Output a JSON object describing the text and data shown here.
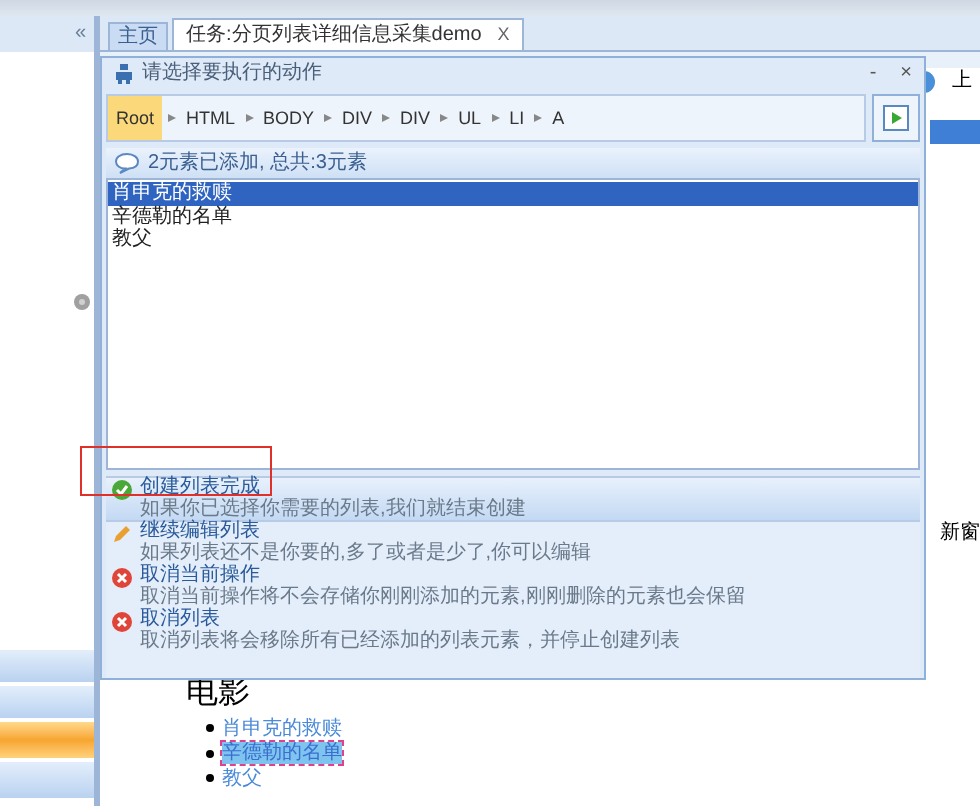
{
  "app": {
    "collapse_glyph": "«",
    "tabs": [
      {
        "label": "主页",
        "selected": false
      },
      {
        "label": "任务:分页列表详细信息采集demo",
        "selected": true
      }
    ],
    "tab_close": "X",
    "right_text": "上",
    "right_side_text": "新窗"
  },
  "dialog": {
    "title": "请选择要执行的动作",
    "minimize": "-",
    "close": "×",
    "breadcrumbs": [
      {
        "label": "Root",
        "selected": true
      },
      {
        "label": "HTML",
        "selected": false
      },
      {
        "label": "BODY",
        "selected": false
      },
      {
        "label": "DIV",
        "selected": false
      },
      {
        "label": "DIV",
        "selected": false
      },
      {
        "label": "UL",
        "selected": false
      },
      {
        "label": "LI",
        "selected": false
      },
      {
        "label": "A",
        "selected": false
      }
    ],
    "status": "2元素已添加, 总共:3元素",
    "elements": [
      {
        "label": "肖申克的救赎",
        "selected": true
      },
      {
        "label": "辛德勒的名单",
        "selected": false
      },
      {
        "label": "教父",
        "selected": false
      }
    ],
    "actions": [
      {
        "kind": "done",
        "title": "创建列表完成",
        "description": "如果你已选择你需要的列表,我们就结束创建",
        "selected": true
      },
      {
        "kind": "edit",
        "title": "继续编辑列表",
        "description": "如果列表还不是你要的,多了或者是少了,你可以编辑",
        "selected": false
      },
      {
        "kind": "cancel",
        "title": "取消当前操作",
        "description": "取消当前操作将不会存储你刚刚添加的元素,刚刚删除的元素也会保留",
        "selected": false
      },
      {
        "kind": "cancel",
        "title": "取消列表",
        "description": "取消列表将会移除所有已经添加的列表元素，并停止创建列表",
        "selected": false
      }
    ]
  },
  "page": {
    "heading": "电影",
    "links": [
      {
        "label": "肖申克的救赎",
        "selected": false
      },
      {
        "label": "辛德勒的名单",
        "selected": true
      },
      {
        "label": "教父",
        "selected": false
      }
    ]
  }
}
